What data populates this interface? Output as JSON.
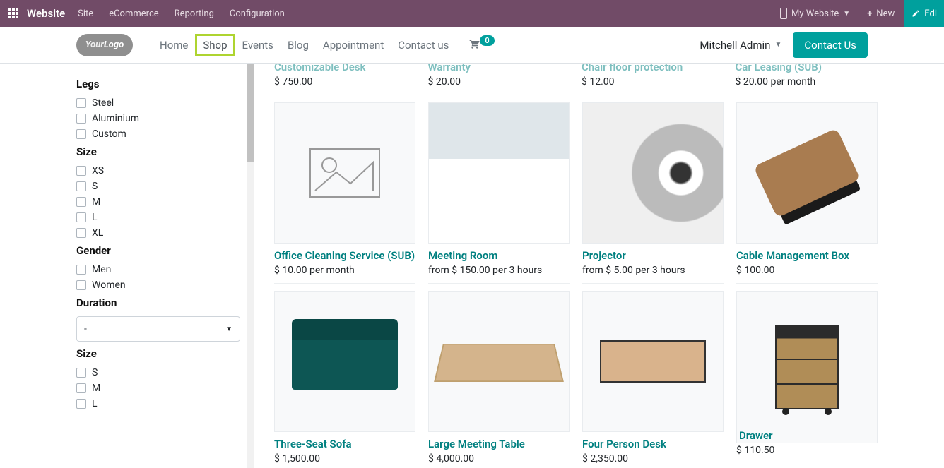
{
  "topbar": {
    "brand": "Website",
    "menu": [
      "Site",
      "eCommerce",
      "Reporting",
      "Configuration"
    ],
    "mywebsite": "My Website",
    "new": "New",
    "edit": "Edi"
  },
  "nav": {
    "links": [
      "Home",
      "Shop",
      "Events",
      "Blog",
      "Appointment",
      "Contact us"
    ],
    "cart_count": "0",
    "user": "Mitchell Admin",
    "contact": "Contact Us"
  },
  "sidebar": {
    "groups": [
      {
        "title": "Legs",
        "items": [
          "Steel",
          "Aluminium",
          "Custom"
        ]
      },
      {
        "title": "Size",
        "items": [
          "XS",
          "S",
          "M",
          "L",
          "XL"
        ]
      },
      {
        "title": "Gender",
        "items": [
          "Men",
          "Women"
        ]
      }
    ],
    "duration": {
      "title": "Duration",
      "value": "-"
    },
    "size2": {
      "title": "Size",
      "items": [
        "S",
        "M",
        "L"
      ]
    }
  },
  "products": {
    "row0": [
      {
        "title": "Customizable Desk",
        "price": "$ 750.00"
      },
      {
        "title": "Warranty",
        "price": "$ 20.00"
      },
      {
        "title": "Chair floor protection",
        "price": "$ 12.00"
      },
      {
        "title": "Car Leasing (SUB)",
        "price": "$ 20.00 per month"
      }
    ],
    "row1": [
      {
        "title": "Office Cleaning Service (SUB)",
        "price": "$ 10.00 per month"
      },
      {
        "title": "Meeting Room",
        "price": "from $ 150.00 per 3 hours"
      },
      {
        "title": "Projector",
        "price": "from $ 5.00 per 3 hours"
      },
      {
        "title": "Cable Management Box",
        "price": "$ 100.00"
      }
    ],
    "row2": [
      {
        "title": "Three-Seat Sofa",
        "price": "$ 1,500.00"
      },
      {
        "title": "Large Meeting Table",
        "price": "$ 4,000.00"
      },
      {
        "title": "Four Person Desk",
        "price": "$ 2,350.00"
      },
      {
        "title": "Drawer",
        "price": "$ 110.50"
      }
    ]
  }
}
